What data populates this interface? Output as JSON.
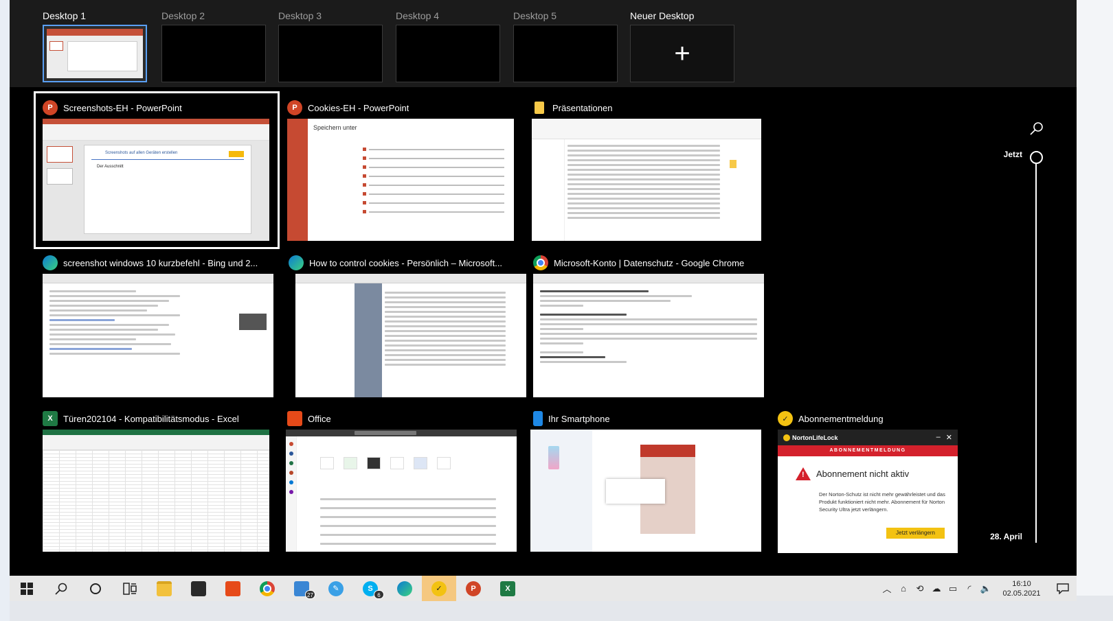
{
  "desktops": [
    {
      "label": "Desktop 1",
      "active": true
    },
    {
      "label": "Desktop 2"
    },
    {
      "label": "Desktop 3"
    },
    {
      "label": "Desktop 4"
    },
    {
      "label": "Desktop 5"
    },
    {
      "label": "Neuer Desktop",
      "new": true
    }
  ],
  "windows": {
    "ppt1": {
      "title": "Screenshots-EH - PowerPoint",
      "slide_title": "Screenshots auf allen Geräten erstellen",
      "slide_text": "Der Ausschnitt"
    },
    "ppt2": {
      "title": "Cookies-EH - PowerPoint",
      "save_title": "Speichern unter"
    },
    "explorer": {
      "title": "Präsentationen"
    },
    "bing": {
      "title": "screenshot windows 10 kurzbefehl - Bing und 2..."
    },
    "ms": {
      "title": "How to control cookies - Persönlich – Microsoft..."
    },
    "chrome": {
      "title": "Microsoft-Konto | Datenschutz - Google Chrome"
    },
    "excel": {
      "title": "Türen202104  -  Kompatibilitätsmodus - Excel"
    },
    "office": {
      "title": "Office"
    },
    "phone": {
      "title": "Ihr Smartphone"
    },
    "norton": {
      "title": "Abonnementmeldung",
      "brand": "NortonLifeLock",
      "band": "ABONNEMENTMELDUNG",
      "alert": "Abonnement nicht aktiv",
      "body": "Der Norton-Schutz ist nicht mehr gewährleistet und das Produkt funktioniert nicht mehr. Abonnement für Norton Security Ultra jetzt verlängern.",
      "button": "Jetzt verlängern"
    }
  },
  "timeline": {
    "now": "Jetzt",
    "date": "28. April"
  },
  "taskbar": {
    "time": "16:10",
    "date": "02.05.2021",
    "badges": {
      "docs": "27",
      "skype": "6"
    }
  },
  "colors": {
    "accent": "#5aa0f5",
    "taskbar_active": "#f5c880",
    "norton_red": "#d4212c",
    "norton_yellow": "#f3c212"
  }
}
